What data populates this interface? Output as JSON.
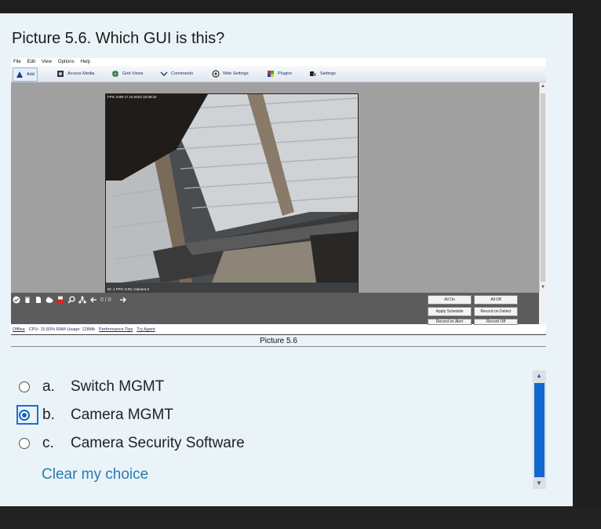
{
  "question": {
    "title": "Picture 5.6. Which GUI is this?"
  },
  "app": {
    "menu": [
      "File",
      "Edit",
      "View",
      "Options",
      "Help"
    ],
    "toolbar": [
      "Add",
      "Access Media",
      "Grid Views",
      "Commands",
      "Web Settings",
      "Plugins",
      "Settings"
    ],
    "camera": {
      "top_overlay": "FPS: 9.99 17.10.2023 15:08:22",
      "bottom_overlay": "ID: 1 FPS: 0.00, Camera 0"
    },
    "counter": "0 / 0",
    "buttons": {
      "all_on": "All On",
      "all_off": "All Off",
      "apply_schedule": "Apply Schedule",
      "record_on_detect": "Record on Detect",
      "record_on_alert": "Record on Alert",
      "record_off": "Record Off"
    },
    "status": {
      "offline": "Offline",
      "usage": "CPU: 15.83% RAM Usage: 128Mb",
      "performance_tips": "Performance Tips",
      "try_agent": "Try Agent"
    }
  },
  "caption": "Picture 5.6",
  "options": [
    {
      "letter": "a.",
      "text": "Switch MGMT",
      "selected": false
    },
    {
      "letter": "b.",
      "text": "Camera MGMT",
      "selected": true
    },
    {
      "letter": "c.",
      "text": "Camera Security Software",
      "selected": false
    }
  ],
  "clear_choice": "Clear my choice",
  "colors": {
    "accent": "#1565c0",
    "link": "#2a7ab0",
    "panel": "#e9f3f8"
  }
}
